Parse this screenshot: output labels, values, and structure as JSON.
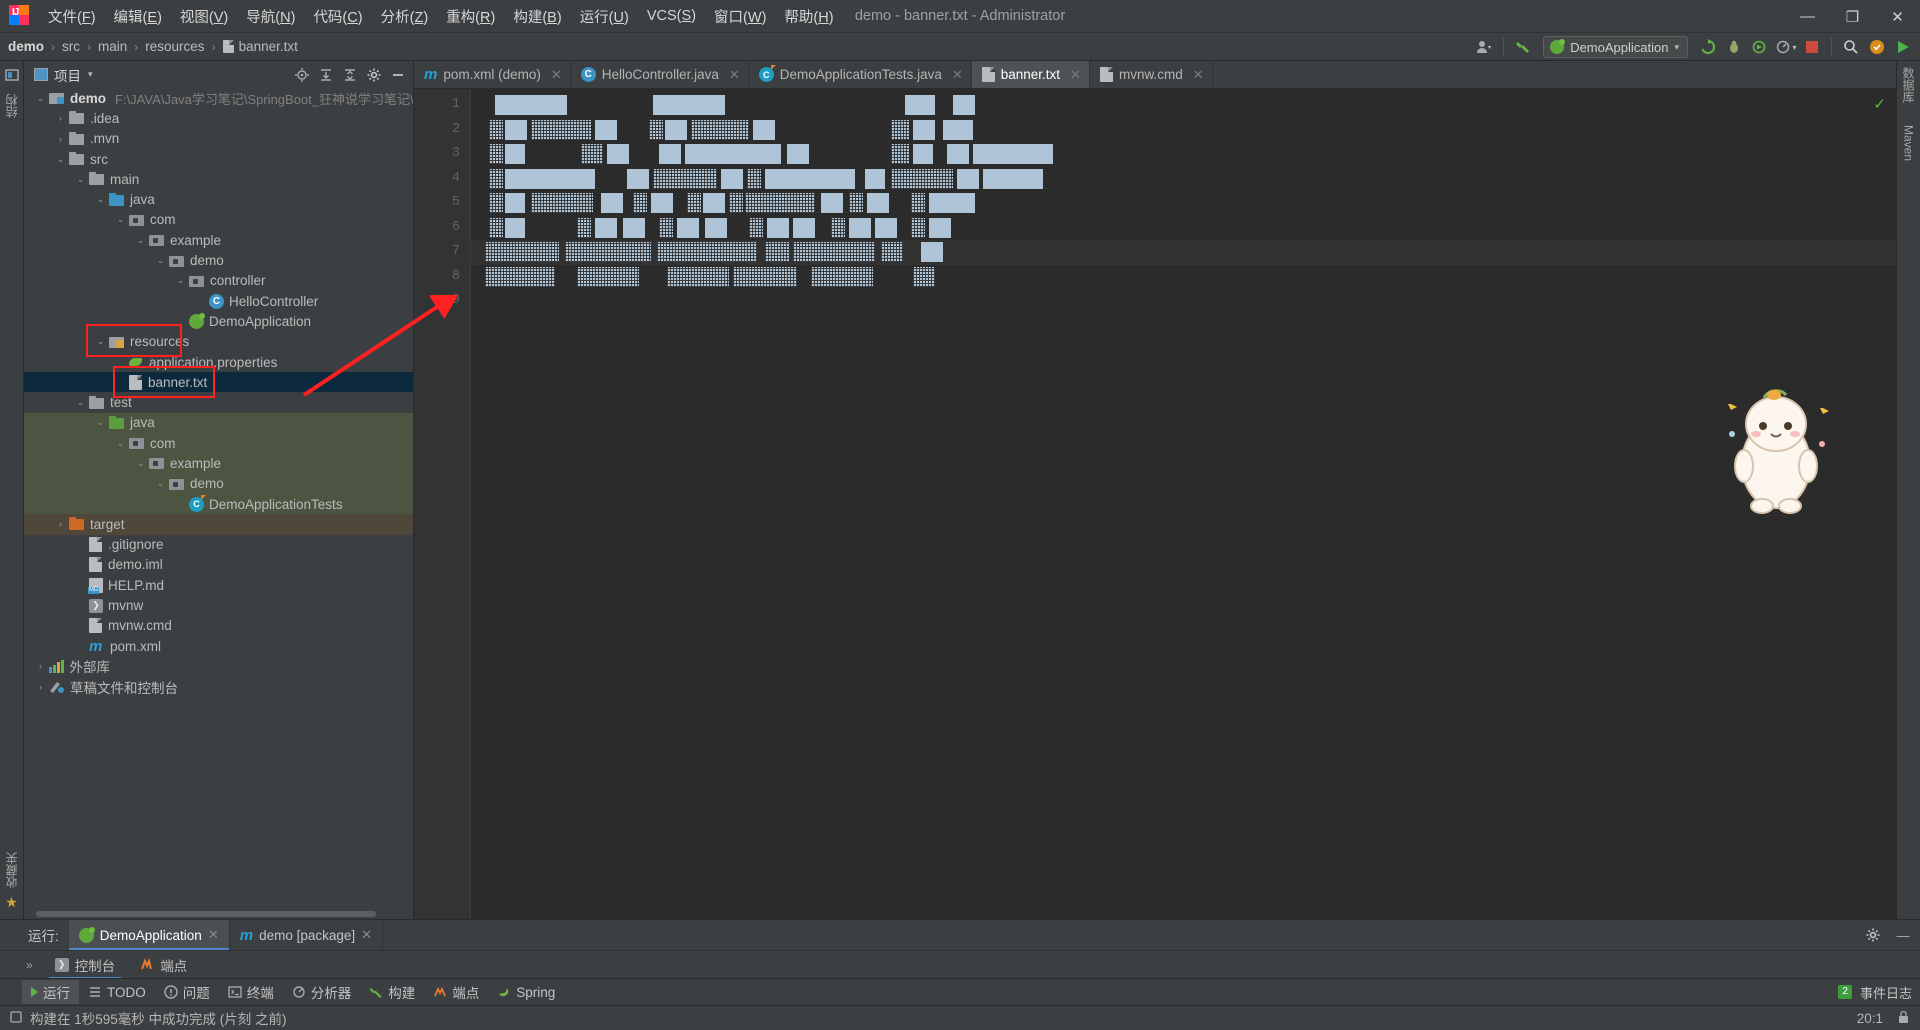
{
  "window": {
    "title": "demo - banner.txt - Administrator",
    "minimize": "—",
    "maximize": "❐",
    "close": "✕"
  },
  "menu": [
    {
      "label": "文件(F)"
    },
    {
      "label": "编辑(E)"
    },
    {
      "label": "视图(V)"
    },
    {
      "label": "导航(N)"
    },
    {
      "label": "代码(C)"
    },
    {
      "label": "分析(Z)"
    },
    {
      "label": "重构(R)"
    },
    {
      "label": "构建(B)"
    },
    {
      "label": "运行(U)"
    },
    {
      "label": "VCS(S)"
    },
    {
      "label": "窗口(W)"
    },
    {
      "label": "帮助(H)"
    }
  ],
  "breadcrumb": {
    "items": [
      "demo",
      "src",
      "main",
      "resources",
      "banner.txt"
    ],
    "separator": "›"
  },
  "toolbar": {
    "run_config": "DemoApplication",
    "run_config_caret": "▾",
    "user_icon": "user-icon",
    "build_icon": "hammer-icon",
    "update_icon": "update-icon",
    "debug_icon": "debug-icon",
    "run_icon": "run-icon",
    "coverage_icon": "coverage-icon",
    "stop_icon": "stop-icon",
    "search_icon": "search-icon",
    "settings_icon": "settings-icon",
    "play_icon": "play-icon"
  },
  "project_panel": {
    "title": "项目",
    "caret": "▾",
    "tools": [
      "locate-icon",
      "expand-all-icon",
      "collapse-all-icon",
      "settings-icon",
      "hide-icon"
    ],
    "tree": [
      {
        "label": "demo",
        "path": "F:\\JAVA\\Java学习笔记\\SpringBoot_狂神说学习笔记\\代",
        "indent": 0,
        "arrow": "⌄",
        "icon": "f-mod",
        "bold": true
      },
      {
        "label": ".idea",
        "indent": 1,
        "arrow": "›",
        "icon": "f-grey"
      },
      {
        "label": ".mvn",
        "indent": 1,
        "arrow": "›",
        "icon": "f-grey"
      },
      {
        "label": "src",
        "indent": 1,
        "arrow": "⌄",
        "icon": "f-grey"
      },
      {
        "label": "main",
        "indent": 2,
        "arrow": "⌄",
        "icon": "f-grey"
      },
      {
        "label": "java",
        "indent": 3,
        "arrow": "⌄",
        "icon": "f-blue"
      },
      {
        "label": "com",
        "indent": 4,
        "arrow": "⌄",
        "icon": "f-pkg"
      },
      {
        "label": "example",
        "indent": 5,
        "arrow": "⌄",
        "icon": "f-pkg"
      },
      {
        "label": "demo",
        "indent": 6,
        "arrow": "⌄",
        "icon": "f-pkg"
      },
      {
        "label": "controller",
        "indent": 7,
        "arrow": "⌄",
        "icon": "f-pkg"
      },
      {
        "label": "HelloController",
        "indent": 8,
        "arrow": "",
        "icon": "c-class",
        "glyph": "C"
      },
      {
        "label": "DemoApplication",
        "indent": 7,
        "arrow": "",
        "icon": "spring-ico"
      },
      {
        "label": "resources",
        "indent": 3,
        "arrow": "⌄",
        "icon": "f-src"
      },
      {
        "label": "application.properties",
        "indent": 4,
        "arrow": "",
        "icon": "prop-ico"
      },
      {
        "label": "banner.txt",
        "indent": 4,
        "arrow": "",
        "icon": "file-ico",
        "selected": true
      },
      {
        "label": "test",
        "indent": 2,
        "arrow": "⌄",
        "icon": "f-grey"
      },
      {
        "label": "java",
        "indent": 3,
        "arrow": "⌄",
        "icon": "f-green",
        "bg": "green"
      },
      {
        "label": "com",
        "indent": 4,
        "arrow": "⌄",
        "icon": "f-pkg",
        "bg": "green"
      },
      {
        "label": "example",
        "indent": 5,
        "arrow": "⌄",
        "icon": "f-pkg",
        "bg": "green"
      },
      {
        "label": "demo",
        "indent": 6,
        "arrow": "⌄",
        "icon": "f-pkg",
        "bg": "green"
      },
      {
        "label": "DemoApplicationTests",
        "indent": 7,
        "arrow": "",
        "icon": "test-ico",
        "glyph": "C",
        "bg": "green"
      },
      {
        "label": "target",
        "indent": 1,
        "arrow": "›",
        "icon": "f-orange",
        "bg": "tan"
      },
      {
        "label": ".gitignore",
        "indent": 2,
        "arrow": "",
        "icon": "file-ico"
      },
      {
        "label": "demo.iml",
        "indent": 2,
        "arrow": "",
        "icon": "file-ico"
      },
      {
        "label": "HELP.md",
        "indent": 2,
        "arrow": "",
        "icon": "md-ico",
        "glyph": "MD"
      },
      {
        "label": "mvnw",
        "indent": 2,
        "arrow": "",
        "icon": "sh-ico",
        "glyph": "❯"
      },
      {
        "label": "mvnw.cmd",
        "indent": 2,
        "arrow": "",
        "icon": "file-ico"
      },
      {
        "label": "pom.xml",
        "indent": 2,
        "arrow": "",
        "icon": "m-ico",
        "glyph": "m"
      },
      {
        "label": "外部库",
        "indent": 0,
        "arrow": "›",
        "icon": "lib-ico"
      },
      {
        "label": "草稿文件和控制台",
        "indent": 0,
        "arrow": "›",
        "icon": "scratch-ico"
      }
    ]
  },
  "editor_tabs": [
    {
      "label": "pom.xml (demo)",
      "icon": "maven-icon",
      "active": false,
      "close": "✕"
    },
    {
      "label": "HelloController.java",
      "icon": "class-icon",
      "active": false,
      "close": "✕"
    },
    {
      "label": "DemoApplicationTests.java",
      "icon": "test-class-icon",
      "active": false,
      "close": "✕"
    },
    {
      "label": "banner.txt",
      "icon": "text-file-icon",
      "active": true,
      "close": "✕"
    },
    {
      "label": "mvnw.cmd",
      "icon": "text-file-icon",
      "active": false,
      "close": "✕"
    }
  ],
  "editor": {
    "line_numbers": [
      "1",
      "2",
      "3",
      "4",
      "5",
      "6",
      "7",
      "8",
      "9"
    ],
    "caret_line": 7,
    "inspection_status": "✓",
    "content_note": "banner ASCII art (obscured block glyphs)",
    "banner_rows": [
      [
        [
          14,
          72,
          "solid"
        ],
        [
          172,
          72,
          "solid"
        ],
        [
          424,
          30,
          "solid"
        ],
        [
          472,
          22,
          "solid"
        ]
      ],
      [
        [
          8,
          14,
          "hatch"
        ],
        [
          24,
          22,
          "solid"
        ],
        [
          50,
          60,
          "hatch"
        ],
        [
          114,
          22,
          "solid"
        ],
        [
          168,
          14,
          "hatch"
        ],
        [
          184,
          22,
          "solid"
        ],
        [
          210,
          58,
          "hatch"
        ],
        [
          272,
          22,
          "solid"
        ],
        [
          410,
          18,
          "hatch"
        ],
        [
          432,
          22,
          "solid"
        ],
        [
          462,
          30,
          "solid"
        ]
      ],
      [
        [
          8,
          14,
          "hatch"
        ],
        [
          24,
          20,
          "solid"
        ],
        [
          100,
          22,
          "hatch"
        ],
        [
          126,
          22,
          "solid"
        ],
        [
          178,
          22,
          "solid"
        ],
        [
          204,
          96,
          "solid"
        ],
        [
          306,
          22,
          "solid"
        ],
        [
          410,
          18,
          "hatch"
        ],
        [
          432,
          20,
          "solid"
        ],
        [
          466,
          22,
          "solid"
        ],
        [
          492,
          80,
          "solid"
        ]
      ],
      [
        [
          8,
          14,
          "hatch"
        ],
        [
          24,
          90,
          "solid"
        ],
        [
          146,
          22,
          "solid"
        ],
        [
          172,
          64,
          "hatch"
        ],
        [
          240,
          22,
          "solid"
        ],
        [
          266,
          14,
          "hatch"
        ],
        [
          284,
          90,
          "solid"
        ],
        [
          384,
          20,
          "solid"
        ],
        [
          410,
          62,
          "hatch"
        ],
        [
          476,
          22,
          "solid"
        ],
        [
          502,
          60,
          "solid"
        ]
      ],
      [
        [
          8,
          14,
          "hatch"
        ],
        [
          24,
          20,
          "solid"
        ],
        [
          50,
          62,
          "hatch"
        ],
        [
          120,
          22,
          "solid"
        ],
        [
          152,
          14,
          "hatch"
        ],
        [
          170,
          22,
          "solid"
        ],
        [
          206,
          14,
          "hatch"
        ],
        [
          222,
          22,
          "solid"
        ],
        [
          248,
          14,
          "hatch"
        ],
        [
          264,
          70,
          "hatch"
        ],
        [
          340,
          22,
          "solid"
        ],
        [
          368,
          14,
          "hatch"
        ],
        [
          386,
          22,
          "solid"
        ],
        [
          430,
          14,
          "hatch"
        ],
        [
          448,
          46,
          "solid"
        ]
      ],
      [
        [
          8,
          14,
          "hatch"
        ],
        [
          24,
          20,
          "solid"
        ],
        [
          96,
          14,
          "hatch"
        ],
        [
          114,
          22,
          "solid"
        ],
        [
          142,
          22,
          "solid"
        ],
        [
          178,
          14,
          "hatch"
        ],
        [
          196,
          22,
          "solid"
        ],
        [
          224,
          22,
          "solid"
        ],
        [
          268,
          14,
          "hatch"
        ],
        [
          286,
          22,
          "solid"
        ],
        [
          312,
          22,
          "solid"
        ],
        [
          350,
          14,
          "hatch"
        ],
        [
          368,
          22,
          "solid"
        ],
        [
          394,
          22,
          "solid"
        ],
        [
          430,
          14,
          "hatch"
        ],
        [
          448,
          22,
          "solid"
        ]
      ],
      [
        [
          4,
          74,
          "hatch"
        ],
        [
          84,
          86,
          "hatch"
        ],
        [
          176,
          100,
          "hatch"
        ],
        [
          284,
          24,
          "hatch"
        ],
        [
          312,
          82,
          "hatch"
        ],
        [
          400,
          22,
          "hatch"
        ],
        [
          440,
          22,
          "solid"
        ]
      ],
      [
        [
          4,
          70,
          "hatch"
        ],
        [
          96,
          62,
          "hatch"
        ],
        [
          186,
          62,
          "hatch"
        ],
        [
          252,
          64,
          "hatch"
        ],
        [
          330,
          62,
          "hatch"
        ],
        [
          432,
          22,
          "hatch"
        ]
      ]
    ]
  },
  "right_strip": [
    {
      "label": "数据库",
      "icon": "database-icon"
    },
    {
      "label": "Maven",
      "icon": "maven-icon"
    }
  ],
  "left_strip": [
    {
      "label": "项目",
      "icon": "project-icon"
    },
    {
      "label": "结构",
      "icon": "structure-icon"
    },
    {
      "label": "收藏夹",
      "icon": "favorites-icon"
    }
  ],
  "run_panel": {
    "label": "运行:",
    "tabs": [
      {
        "label": "DemoApplication",
        "icon": "spring-icon",
        "active": true,
        "close": "✕"
      },
      {
        "label": "demo [package]",
        "icon": "maven-icon",
        "active": false,
        "close": "✕"
      }
    ],
    "settings_icon": "gear-icon",
    "minimize_icon": "—",
    "chevron": "»",
    "subtabs": [
      {
        "label": "控制台",
        "icon": "console-icon",
        "active": true
      },
      {
        "label": "端点",
        "icon": "endpoints-icon",
        "active": false
      }
    ]
  },
  "tool_strip": {
    "buttons": [
      {
        "label": "运行",
        "icon": "run-icon",
        "selected": true
      },
      {
        "label": "TODO",
        "icon": "todo-icon",
        "selected": false
      },
      {
        "label": "问题",
        "icon": "problems-icon",
        "selected": false
      },
      {
        "label": "终端",
        "icon": "terminal-icon",
        "selected": false
      },
      {
        "label": "分析器",
        "icon": "profiler-icon",
        "selected": false
      },
      {
        "label": "构建",
        "icon": "build-icon",
        "selected": false
      },
      {
        "label": "端点",
        "icon": "endpoints-icon",
        "selected": false
      },
      {
        "label": "Spring",
        "icon": "spring-icon",
        "selected": false
      }
    ],
    "event_log": "事件日志",
    "event_count": "2"
  },
  "status_bar": {
    "message": "构建在 1秒595毫秒 中成功完成 (片刻 之前)",
    "caret_position": "20:1",
    "lock_icon": "lock-icon",
    "message_icon": "message-icon"
  },
  "colors": {
    "accent_blue": "#4a88c7",
    "selection": "#0d293e",
    "test_green_bg": "#4c5442",
    "target_tan_bg": "#4f483a",
    "annotation_red": "#ff2020",
    "success_green": "#62b543",
    "bg": "#3c3f41",
    "editor_bg": "#2b2b2b"
  }
}
